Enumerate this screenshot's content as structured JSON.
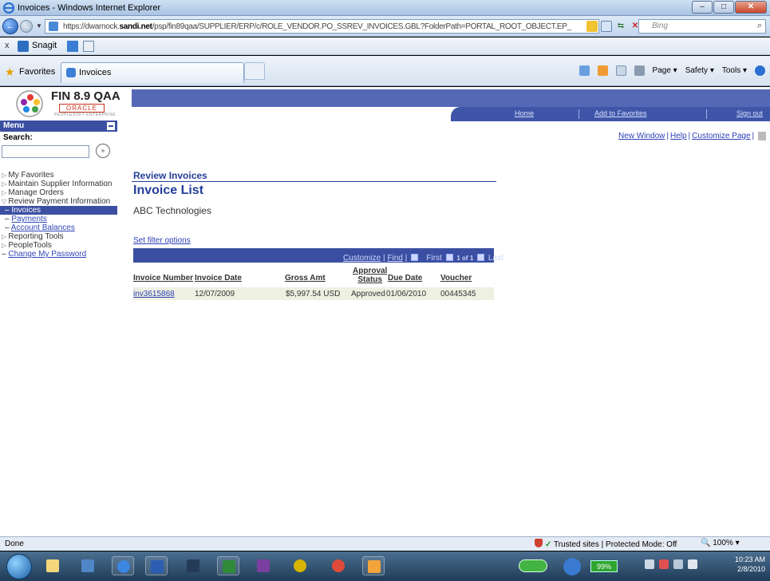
{
  "window": {
    "title": "Invoices - Windows Internet Explorer"
  },
  "browser": {
    "url_prefix": "https://dwarnock.",
    "url_domain": "sandi.net",
    "url_rest": "/psp/fin89qaa/SUPPLIER/ERP/c/ROLE_VENDOR.PO_SSREV_INVOICES.GBL?FolderPath=PORTAL_ROOT_OBJECT.EP_",
    "search_placeholder": "Bing",
    "toolbar_x": "x",
    "snagit": "Snagit",
    "favorites": "Favorites",
    "tab_title": "Invoices",
    "cmd_page": "Page ▾",
    "cmd_safety": "Safety ▾",
    "cmd_tools": "Tools ▾"
  },
  "app": {
    "logo_title": "FIN 8.9 QAA",
    "logo_oracle": "ORACLE",
    "logo_sub": "PEOPLESOFT ENTERPRISE",
    "header_links": {
      "home": "Home",
      "add_favorites": "Add to Favorites",
      "sign_out": "Sign out"
    },
    "top_links": {
      "new_window": "New Window",
      "help": "Help",
      "customize": "Customize Page"
    }
  },
  "menu": {
    "title": "Menu",
    "search_label": "Search:",
    "search_go": "»",
    "items": [
      {
        "label": "My Favorites",
        "type": "folder"
      },
      {
        "label": "Maintain Supplier Information",
        "type": "folder"
      },
      {
        "label": "Manage Orders",
        "type": "folder"
      },
      {
        "label": "Review Payment Information",
        "type": "open"
      },
      {
        "label": "Invoices",
        "type": "active"
      },
      {
        "label": "Payments",
        "type": "link"
      },
      {
        "label": "Account Balances",
        "type": "link"
      },
      {
        "label": "Reporting Tools",
        "type": "folder"
      },
      {
        "label": "PeopleTools",
        "type": "folder"
      },
      {
        "label": "Change My Password",
        "type": "link"
      }
    ]
  },
  "content": {
    "breadcrumb": "Review Invoices",
    "title": "Invoice List",
    "vendor": "ABC Technologies",
    "filter_link": "Set filter options",
    "grid_nav": {
      "customize": "Customize",
      "find": "Find",
      "first": "First",
      "range": "1 of 1",
      "last": "Last"
    },
    "columns": {
      "invoice_number": "Invoice Number",
      "invoice_date": "Invoice Date",
      "gross_amt": "Gross Amt",
      "approval_status_1": "Approval",
      "approval_status_2": "Status",
      "due_date": "Due Date",
      "voucher": "Voucher"
    },
    "rows": [
      {
        "invoice_number": "inv3615868",
        "invoice_date": "12/07/2009",
        "gross_amt": "$5,997.54 USD",
        "approval_status": "Approved",
        "due_date": "01/06/2010",
        "voucher": "00445345"
      }
    ]
  },
  "status": {
    "left": "Done",
    "zone": "Trusted sites | Protected Mode: Off",
    "zoom": "100%"
  },
  "taskbar": {
    "battery": "99%",
    "time": "10:23 AM",
    "date": "2/8/2010"
  }
}
